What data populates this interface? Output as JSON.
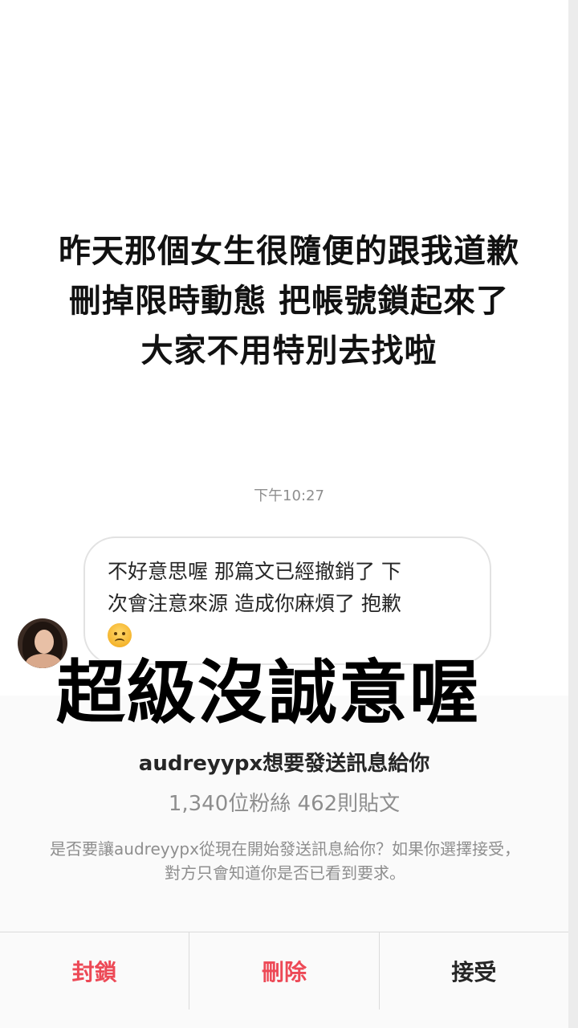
{
  "story": {
    "caption_lines": [
      "昨天那個女生很隨便的跟我道歉",
      "刪掉限時動態 把帳號鎖起來了",
      "大家不用特別去找啦"
    ]
  },
  "chat": {
    "timestamp": "下午10:27",
    "message_lines": [
      "不好意思喔 那篇文已經撤銷了 下",
      "次會注意來源 造成你麻煩了 抱歉"
    ],
    "message_emoji": "sad-sweat-face-emoji"
  },
  "overlay": {
    "text": "超級沒誠意喔"
  },
  "request": {
    "title": "audreyypx想要發送訊息給你",
    "stats": "1,340位粉絲 462則貼文",
    "info": "是否要讓audreyypx從現在開始發送訊息給你？如果你選擇接受，對方只會知道你是否已看到要求。"
  },
  "actions": {
    "block_label": "封鎖",
    "delete_label": "刪除",
    "accept_label": "接受"
  },
  "colors": {
    "danger": "#ed4956",
    "text_primary": "#262626",
    "text_secondary": "#8e8e8e"
  }
}
